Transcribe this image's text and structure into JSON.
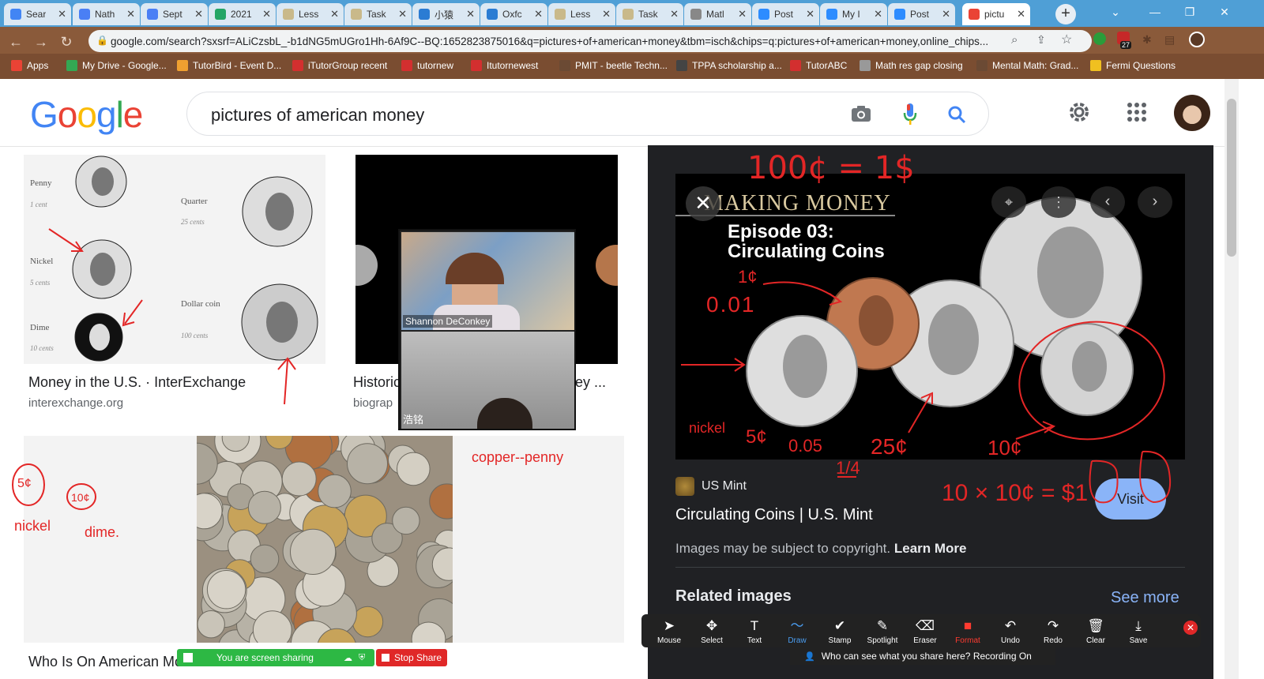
{
  "tabs": [
    {
      "label": "Sear",
      "fav": "#4285f4",
      "active": false
    },
    {
      "label": "Nath",
      "fav": "#4a7ff5",
      "active": false
    },
    {
      "label": "Sept",
      "fav": "#4a7ff5",
      "active": false
    },
    {
      "label": "2021",
      "fav": "#23a566",
      "active": false
    },
    {
      "label": "Less",
      "fav": "#c9b98a",
      "active": false
    },
    {
      "label": "Task",
      "fav": "#c9b98a",
      "active": false
    },
    {
      "label": "小猿",
      "fav": "#2b7cd3",
      "active": false
    },
    {
      "label": "Oxfc",
      "fav": "#2b7cd3",
      "active": false
    },
    {
      "label": "Less",
      "fav": "#c9b98a",
      "active": false
    },
    {
      "label": "Task",
      "fav": "#c9b98a",
      "active": false
    },
    {
      "label": "Matl",
      "fav": "#888888",
      "active": false
    },
    {
      "label": "Post",
      "fav": "#2d8cff",
      "active": false
    },
    {
      "label": "My I",
      "fav": "#2d8cff",
      "active": false
    },
    {
      "label": "Post",
      "fav": "#2d8cff",
      "active": false
    },
    {
      "label": "pictu",
      "fav": "#ea4335",
      "active": true
    }
  ],
  "new_tab_label": "+",
  "window": {
    "minimize": "—",
    "restore": "❐",
    "close": "✕",
    "dropdown": "⌄"
  },
  "address": {
    "url": "google.com/search?sxsrf=ALiCzsbL_-b1dNG5mUGro1Hh-6Af9C--BQ:1652823875016&q=pictures+of+american+money&tbm=isch&chips=q:pictures+of+american+money,online_chips..."
  },
  "extension_badge": "27",
  "bookmarks": [
    {
      "label": "Apps",
      "icon": "#ea4335"
    },
    {
      "label": "My Drive - Google...",
      "icon": "#34a853"
    },
    {
      "label": "TutorBird - Event D...",
      "icon": "#f0a030"
    },
    {
      "label": "iTutorGroup recent",
      "icon": "#d32f2f"
    },
    {
      "label": "tutornew",
      "icon": "#d32f2f"
    },
    {
      "label": "Itutornewest",
      "icon": "#d32f2f"
    },
    {
      "label": "PMIT - beetle Techn...",
      "icon": "#6b4a34"
    },
    {
      "label": "TPPA scholarship a...",
      "icon": "#444444"
    },
    {
      "label": "TutorABC",
      "icon": "#d32f2f"
    },
    {
      "label": "Math res gap closing",
      "icon": "#999999"
    },
    {
      "label": "Mental Math: Grad...",
      "icon": "#6b4a34"
    },
    {
      "label": "Fermi Questions",
      "icon": "#f0c020"
    }
  ],
  "google": {
    "logo": "Google",
    "query": "pictures of american money"
  },
  "results": [
    {
      "title": "Money in the U.S. · InterExchange",
      "source": "interexchange.org"
    },
    {
      "title": "Historic",
      "title_tail": "ey ...",
      "source": "biograp"
    },
    {
      "title": "Who Is On American Mo",
      "source": ""
    }
  ],
  "coin_chart": {
    "labels": [
      {
        "name": "Penny",
        "value": "1 cent"
      },
      {
        "name": "Quarter",
        "value": "25 cents"
      },
      {
        "name": "Nickel",
        "value": "5 cents"
      },
      {
        "name": "Dollar coin",
        "value": "100 cents"
      },
      {
        "name": "Dime",
        "value": "10 cents"
      }
    ]
  },
  "video": {
    "teacher_name": "Shannon DeConkey",
    "student_name": "浩铭"
  },
  "preview": {
    "image_title": "MAKING MONEY",
    "episode": "Episode 03:",
    "episode_sub": "Circulating Coins",
    "source_name": "US Mint",
    "page_title": "Circulating Coins | U.S. Mint",
    "visit_label": "Visit",
    "copyright": "Images may be subject to copyright.",
    "learn_more": "Learn More",
    "related": "Related images",
    "see_more": "See more"
  },
  "annotations": {
    "top_eq": "100¢ = 1$",
    "penny_1c": "1¢",
    "penny_dec": "0.01",
    "nickel": "nickel",
    "nickel_5c": "5¢",
    "nickel_dec": "0.05",
    "quarter": "25¢",
    "quarter_frac": "1/4",
    "dime": "10¢",
    "dime_eq": "10 × 10¢ = $1",
    "left_5c": "5¢",
    "left_10c": "10¢",
    "left_nickel": "nickel",
    "left_dime": "dime.",
    "copper": "copper--penny",
    "color": "#e32626"
  },
  "zoom": {
    "tools": [
      {
        "label": "Mouse",
        "icon": "➤"
      },
      {
        "label": "Select",
        "icon": "✥"
      },
      {
        "label": "Text",
        "icon": "T"
      },
      {
        "label": "Draw",
        "icon": "〜"
      },
      {
        "label": "Stamp",
        "icon": "✔"
      },
      {
        "label": "Spotlight",
        "icon": "✎"
      },
      {
        "label": "Eraser",
        "icon": "⌫"
      },
      {
        "label": "Format",
        "icon": "■"
      },
      {
        "label": "Undo",
        "icon": "↶"
      },
      {
        "label": "Redo",
        "icon": "↷"
      },
      {
        "label": "Clear",
        "icon": "🗑"
      },
      {
        "label": "Save",
        "icon": "⤓"
      }
    ],
    "sharing": "You are screen sharing",
    "stop_share": "Stop Share",
    "who_can_see": "Who can see what you share here? Recording On"
  }
}
